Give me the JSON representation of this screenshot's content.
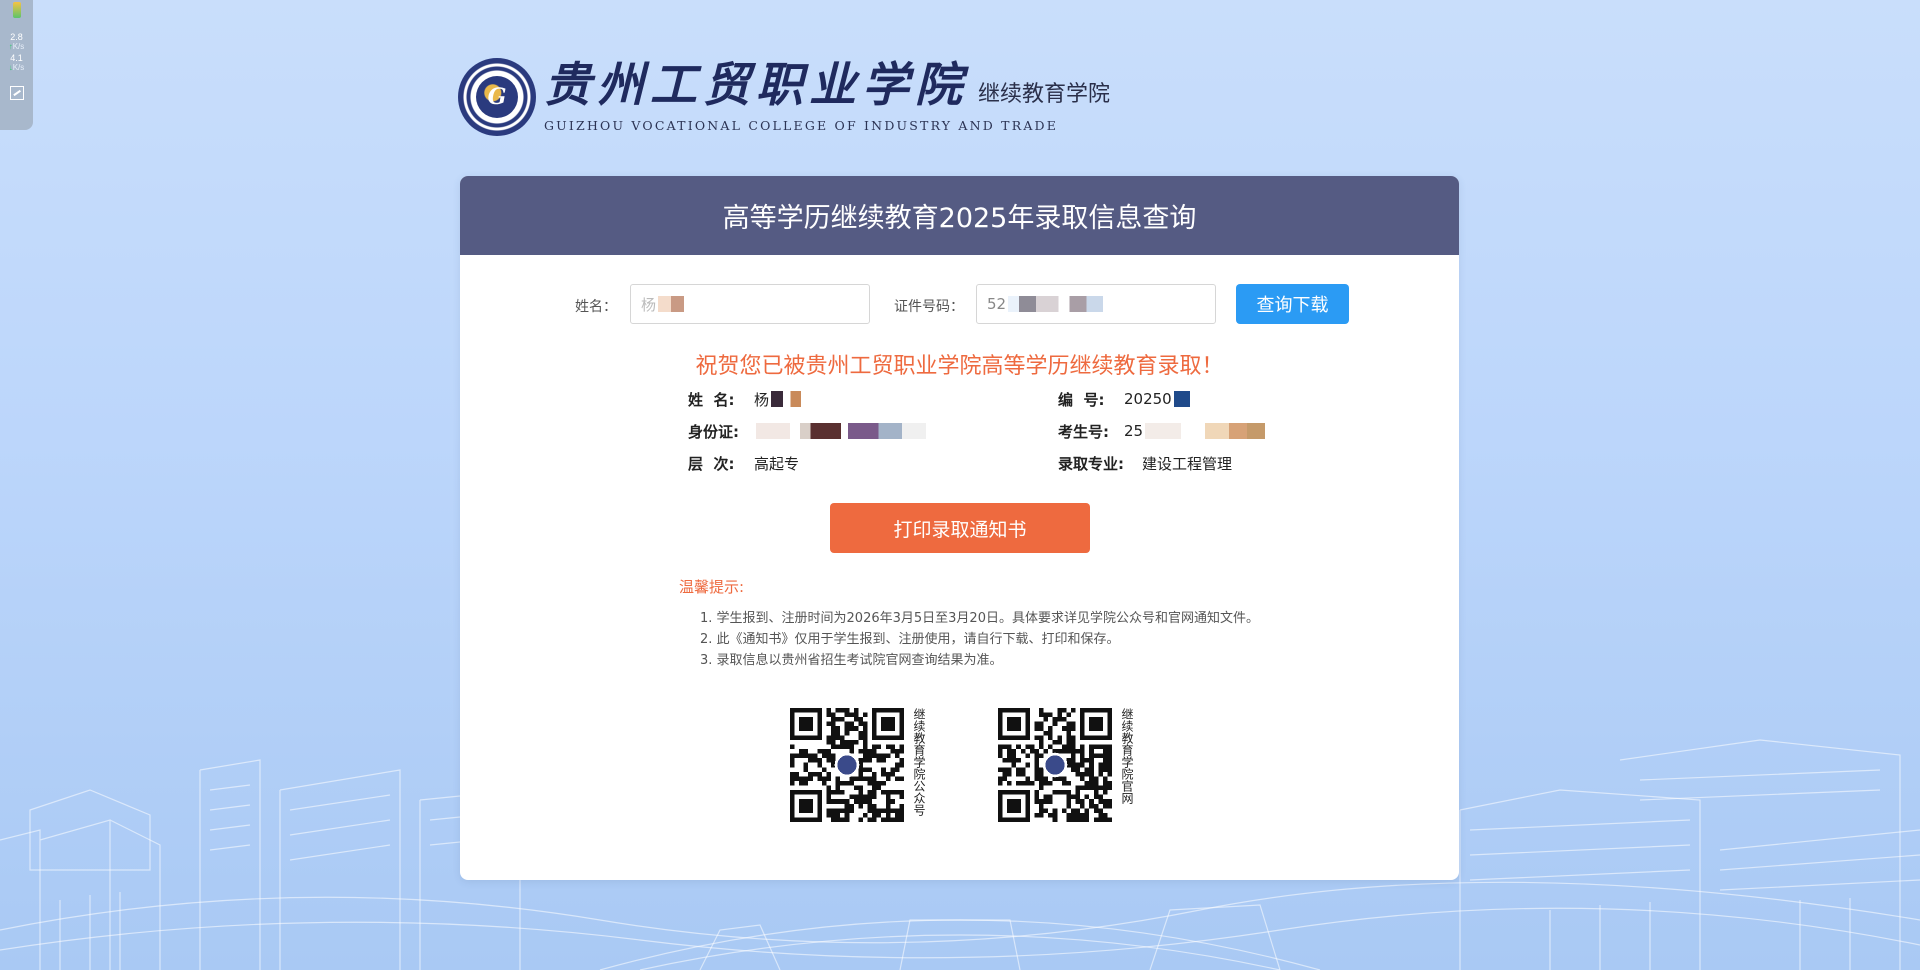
{
  "speed_widget": {
    "upload_value": "2.8",
    "upload_unit": "K/s",
    "download_value": "4.1",
    "download_unit": "K/s",
    "icon": "screenshot-icon"
  },
  "header": {
    "college_name_cn": "贵州工贸职业学院",
    "department": "继续教育学院",
    "college_name_en": "GUIZHOU VOCATIONAL COLLEGE OF INDUSTRY AND TRADE",
    "seal_letter": "G"
  },
  "card": {
    "title": "高等学历继续教育2025年录取信息查询",
    "search": {
      "name_label": "姓名：",
      "name_value": "杨",
      "id_label": "证件号码：",
      "id_value": "52",
      "query_button": "查询下载"
    },
    "congrats": "祝贺您已被贵州工贸职业学院高等学历继续教育录取！",
    "info": {
      "name_key": "姓  名:",
      "name_value": "杨",
      "number_key": "编  号:",
      "number_value": "20250",
      "id_key": "身份证:",
      "id_value": "",
      "exam_no_key": "考生号:",
      "exam_no_value": "25",
      "level_key": "层  次:",
      "level_value": "高起专",
      "major_key": "录取专业:",
      "major_value": "建设工程管理"
    },
    "print_button": "打印录取通知书",
    "tips_title": "温馨提示:",
    "tips": [
      "1. 学生报到、注册时间为2026年3月5日至3月20日。具体要求详见学院公众号和官网通知文件。",
      "2. 此《通知书》仅用于学生报到、注册使用，请自行下载、打印和保存。",
      "3. 录取信息以贵州省招生考试院官网查询结果为准。"
    ],
    "qr_codes": [
      {
        "caption": "继续教育学院公众号"
      },
      {
        "caption": "继续教育学院官网"
      }
    ]
  },
  "colors": {
    "header_bg": "#555b83",
    "accent_orange": "#ee6a3f",
    "query_blue": "#2b9bf4",
    "page_bg": "#c9defb"
  }
}
